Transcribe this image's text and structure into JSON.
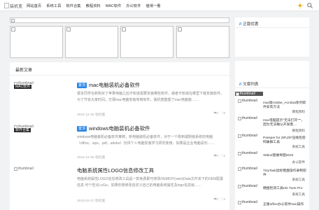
{
  "header": {
    "logo_text": "装机宽",
    "nav": [
      "网站首页",
      "系统工具",
      "软件合集",
      "教程资料",
      "MAC软件",
      "办公软件",
      "值得一看"
    ]
  },
  "main": {
    "section_title": "最新文章",
    "articles": [
      {
        "placeholder": "thumbnail",
        "category_label": "MAC软件",
        "tag": "置顶",
        "title": "mac电脑装机必备软件",
        "excerpt": "很多同学在新购买了苹果电脑之后不知道需要安装哪些软件，或者不知道在哪里下载安装软件。为了节省大家时间，方便mac电脑安装常用软件，装机宽整理了mac电脑装……",
        "date": "2022-12-25 装机宽",
        "stats": [
          "❤0",
          "♡6"
        ]
      },
      {
        "placeholder": "thumbnail",
        "category_label": "软件合集",
        "tag": "置顶",
        "title": "windows电脑装机必备软件",
        "excerpt": "windows电脑装机必备软件推荐，新电脑装机必备软件，对于一个刚到或刚装系统的电脑（office，wps，pdf，adobe）仅供个人电脑安装学习研究使用，如果是企业电脑请勿……",
        "date": "2022-12-09 装机宽",
        "stats": [
          "❤0",
          "♡2"
        ]
      },
      {
        "placeholder": "thumbnail",
        "category_label": "",
        "tag": "",
        "title": "电脑系统属性LOGO信息修改工具",
        "excerpt": "电脑系统属性LOGO信息修改工具是一款免费即可修改OEMDIY(oem)Data文件夹下的OEM配置信息 可个性化LoGo。如果你想修改自定义自己的电脑系统属性及logo信息就……",
        "date": "2023-02-27 装机宽",
        "stats": [
          "❤0",
          "♡2"
        ]
      }
    ]
  },
  "sidebar": {
    "section1_title": "正版优惠",
    "section2_title": "文章列表",
    "items": [
      {
        "label": "thumbnail",
        "title": "",
        "category": ""
      },
      {
        "label": "thumbnail",
        "title": "mac版Adobe_Acrobat系列软件安装方法",
        "category": "教程资料"
      },
      {
        "label": "thumbnail",
        "title": "mac电脑提示\"无法打开\"\"\"，因为无法确认开发者…",
        "category": "教程资料"
      },
      {
        "label": "thumbnail",
        "title": "Passper for ZIP,ZIP压缩包密码破解工具",
        "category": "系统工具"
      },
      {
        "label": "thumbnail",
        "title": "XMind思维导图2022",
        "category": "办公软件"
      },
      {
        "label": "thumbnail",
        "title": "TinyTask鼠标键盘操作录制软件",
        "category": "系统工具"
      },
      {
        "label": "thumbnail",
        "title": "硬盘检测工具HD Tune Pro",
        "category": "系统工具"
      },
      {
        "label": "thumbnail",
        "title": "正版office办公软件/win操作",
        "category": ""
      }
    ]
  },
  "colors": {
    "accent": "#2a86e8",
    "dark_label": "#2a2a2a"
  }
}
